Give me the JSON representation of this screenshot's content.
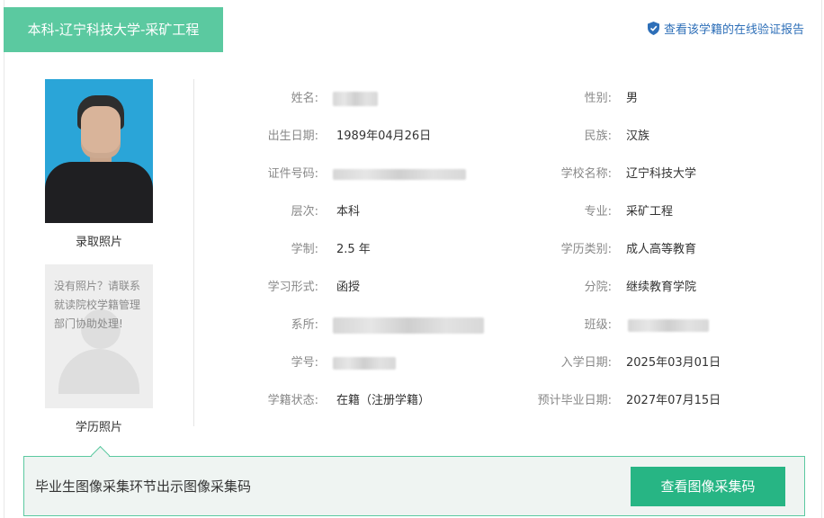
{
  "header": {
    "title": "本科-辽宁科技大学-采矿工程",
    "verify_link": "查看该学籍的在线验证报告"
  },
  "photos": {
    "admission_label": "录取照片",
    "education_label": "学历照片",
    "no_photo_message": "没有照片？请联系就读院校学籍管理部门协助处理!"
  },
  "fields": {
    "name": {
      "label": "姓名:",
      "value": ""
    },
    "gender": {
      "label": "性别:",
      "value": "男"
    },
    "birth": {
      "label": "出生日期:",
      "value": "1989年04月26日"
    },
    "ethnicity": {
      "label": "民族:",
      "value": "汉族"
    },
    "id_number": {
      "label": "证件号码:",
      "value": ""
    },
    "school": {
      "label": "学校名称:",
      "value": "辽宁科技大学"
    },
    "level": {
      "label": "层次:",
      "value": "本科"
    },
    "major": {
      "label": "专业:",
      "value": "采矿工程"
    },
    "duration": {
      "label": "学制:",
      "value": "2.5 年"
    },
    "edu_type": {
      "label": "学历类别:",
      "value": "成人高等教育"
    },
    "study_form": {
      "label": "学习形式:",
      "value": "函授"
    },
    "branch": {
      "label": "分院:",
      "value": "继续教育学院"
    },
    "department": {
      "label": "系所:",
      "value": ""
    },
    "class": {
      "label": "班级:",
      "value": ""
    },
    "student_no": {
      "label": "学号:",
      "value": ""
    },
    "enroll_date": {
      "label": "入学日期:",
      "value": "2025年03月01日"
    },
    "status": {
      "label": "学籍状态:",
      "value": "在籍（注册学籍）"
    },
    "grad_date": {
      "label": "预计毕业日期:",
      "value": "2027年07月15日"
    }
  },
  "banner": {
    "text": "毕业生图像采集环节出示图像采集码",
    "button": "查看图像采集码"
  },
  "colors": {
    "accent": "#5bc9a0",
    "button": "#27b584",
    "link": "#2e6fb8"
  }
}
